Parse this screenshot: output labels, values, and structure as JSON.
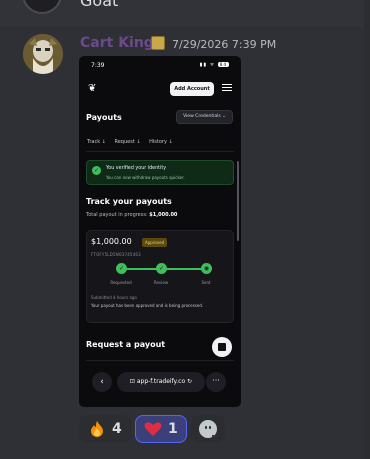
{
  "previous_message": {
    "text": "Goat"
  },
  "message": {
    "username": "Cart King",
    "timestamp": "7/29/2026 7:39 PM",
    "username_color": "#6a4a8c"
  },
  "attachment": {
    "status_time": "7:39",
    "status_icons": "▮▮ ᯤ",
    "battery": "84",
    "add_account_label": "Add Account",
    "payouts_title": "Payouts",
    "view_credentials_label": "View Credentials ⌄",
    "filters": [
      "Track ↓",
      "Request ↓",
      "History ↓"
    ],
    "verified_title": "You verified your identity",
    "verified_subtitle": "You can now withdraw payouts quicker.",
    "track_title": "Track your payouts",
    "total_label": "Total payout in progress: ",
    "total_value": "$1,000.00",
    "card": {
      "amount": "$1,000.00",
      "status_badge": "Approved",
      "transaction_id": "FTOFY5LD5N03745463",
      "steps": [
        "Requested",
        "Review",
        "Sent"
      ],
      "submitted": "Submitted 4 hours ago",
      "status_message": "Your payout has been approved and is being processed."
    },
    "request_title": "Request a payout",
    "url": "app-f.tradeify.co",
    "accent_green": "#3fbf5c"
  },
  "reactions": [
    {
      "emoji": "fire-emoji",
      "count": "4"
    },
    {
      "emoji": "heart-emoji",
      "count": "1",
      "active": true
    }
  ]
}
